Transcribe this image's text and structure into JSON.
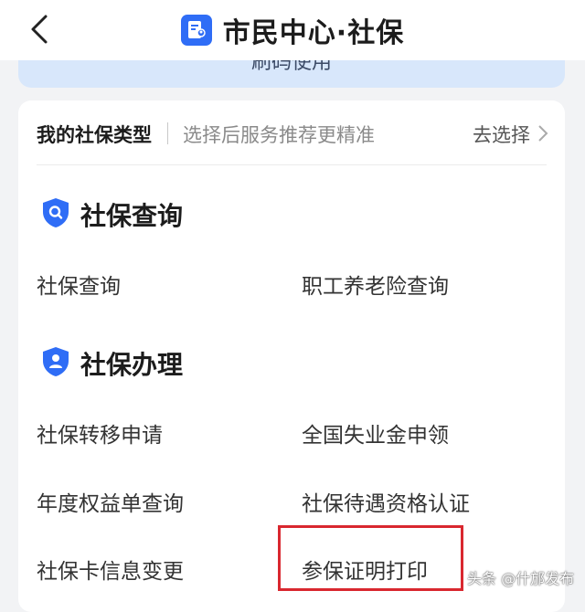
{
  "header": {
    "title": "市民中心·社保"
  },
  "banner": {
    "text": "刷码使用"
  },
  "type_row": {
    "label": "我的社保类型",
    "hint": "选择后服务推荐更精准",
    "choose": "去选择"
  },
  "sections": [
    {
      "title": "社保查询",
      "icon": "search-shield-icon"
    },
    {
      "title": "社保办理",
      "icon": "person-shield-icon"
    }
  ],
  "items": [
    "社保查询",
    "职工养老险查询",
    "社保转移申请",
    "全国失业金申领",
    "年度权益单查询",
    "社保待遇资格认证",
    "社保卡信息变更",
    "参保证明打印"
  ],
  "watermark": "头条 @什邡发布",
  "colors": {
    "accent": "#2f6df6",
    "highlight": "#d9272f",
    "banner": "#d8e7fb"
  }
}
